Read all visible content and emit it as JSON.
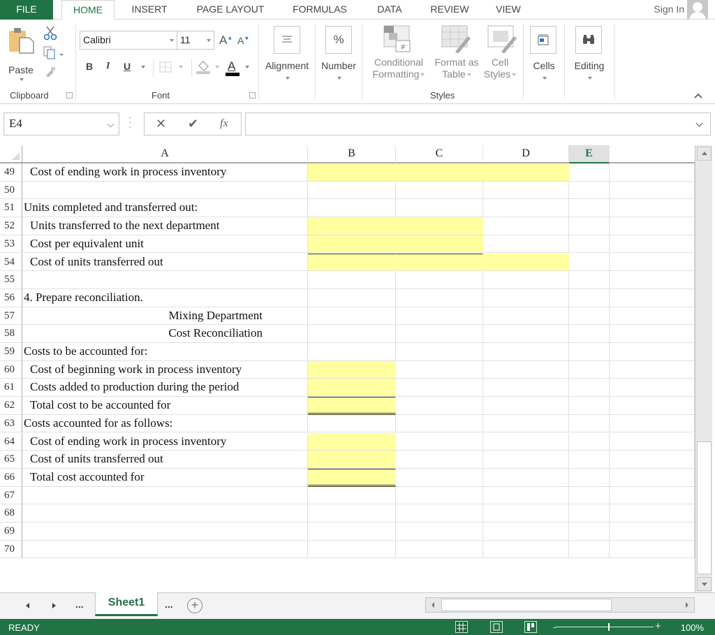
{
  "ribbon_tabs": [
    {
      "label": "FILE"
    },
    {
      "label": "HOME"
    },
    {
      "label": "INSERT"
    },
    {
      "label": "PAGE LAYOUT"
    },
    {
      "label": "FORMULAS"
    },
    {
      "label": "DATA"
    },
    {
      "label": "REVIEW"
    },
    {
      "label": "VIEW"
    }
  ],
  "active_tab": "HOME",
  "account": {
    "signin_label": "Sign In"
  },
  "ribbon": {
    "clipboard": {
      "paste_label": "Paste",
      "group_label": "Clipboard"
    },
    "font": {
      "font_name": "Calibri",
      "font_size": "11",
      "bold": "B",
      "italic": "I",
      "underline": "U",
      "group_label": "Font"
    },
    "alignment": {
      "label": "Alignment"
    },
    "number": {
      "label": "Number",
      "icon_glyph": "%"
    },
    "styles": {
      "conditional_formatting": [
        "Conditional",
        "Formatting"
      ],
      "format_as_table": [
        "Format as",
        "Table"
      ],
      "cell_styles": [
        "Cell",
        "Styles"
      ],
      "group_label": "Styles"
    },
    "cells": {
      "label": "Cells"
    },
    "editing": {
      "label": "Editing"
    }
  },
  "formula_bar": {
    "name_box": "E4",
    "fx_label": "fx",
    "formula_value": ""
  },
  "columns": [
    "A",
    "B",
    "C",
    "D",
    "E"
  ],
  "selected_column": "E",
  "rows": [
    {
      "num": "49",
      "a": "Cost of ending work in process inventory",
      "indent": 1
    },
    {
      "num": "50",
      "a": ""
    },
    {
      "num": "51",
      "a": "Units completed and transferred out:",
      "indent": 0
    },
    {
      "num": "52",
      "a": "Units transferred to the next department",
      "indent": 1
    },
    {
      "num": "53",
      "a": "Cost per equivalent unit",
      "indent": 1
    },
    {
      "num": "54",
      "a": "Cost of units transferred out",
      "indent": 1
    },
    {
      "num": "55",
      "a": ""
    },
    {
      "num": "56",
      "a": "4. Prepare reconciliation.",
      "indent": 0
    },
    {
      "num": "57",
      "a": "Mixing Department",
      "center": true
    },
    {
      "num": "58",
      "a": "Cost Reconciliation",
      "center": true
    },
    {
      "num": "59",
      "a": "Costs to be accounted for:",
      "indent": 0
    },
    {
      "num": "60",
      "a": "Cost of beginning work in process inventory",
      "indent": 1
    },
    {
      "num": "61",
      "a": "Costs added to production during the period",
      "indent": 1
    },
    {
      "num": "62",
      "a": "Total cost to be accounted for",
      "indent": 1
    },
    {
      "num": "63",
      "a": "Costs accounted for as follows:",
      "indent": 0
    },
    {
      "num": "64",
      "a": "Cost of ending work in process inventory",
      "indent": 1
    },
    {
      "num": "65",
      "a": "Cost of units transferred out",
      "indent": 1
    },
    {
      "num": "66",
      "a": "Total cost accounted for",
      "indent": 1
    },
    {
      "num": "67",
      "a": ""
    },
    {
      "num": "68",
      "a": ""
    },
    {
      "num": "69",
      "a": ""
    },
    {
      "num": "70",
      "a": ""
    }
  ],
  "input_cell_color": "#ffff9f",
  "sheet_tabs": {
    "active": "Sheet1",
    "ellipsis": "..."
  },
  "status": {
    "text": "READY",
    "zoom": "100%"
  },
  "colors": {
    "accent": "#217346"
  }
}
